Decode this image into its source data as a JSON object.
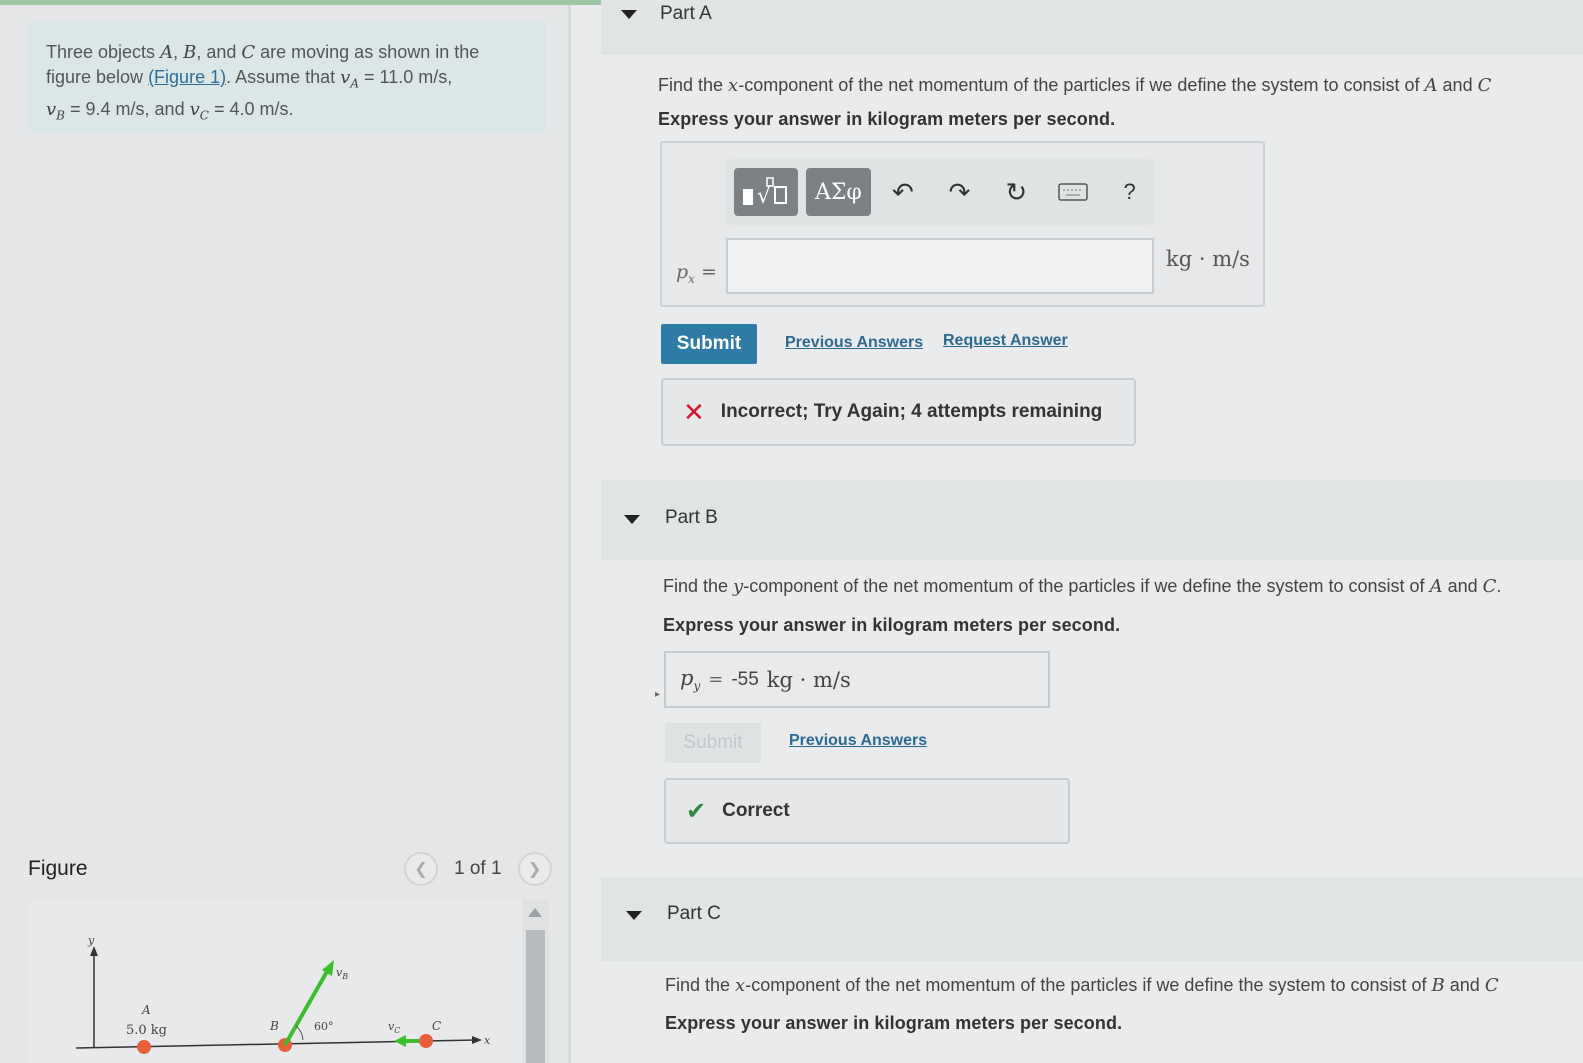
{
  "problem": {
    "intro_1": "Three objects ",
    "obj_a": "A",
    "sep_1": ", ",
    "obj_b": "B",
    "sep_2": ", and ",
    "obj_c": "C",
    "intro_2": " are moving as shown in the",
    "intro_3": "figure below ",
    "figure_link": "(Figure 1)",
    "intro_4": ". Assume that ",
    "va_eq": "v",
    "va_sub": "A",
    "va_val": " = 11.0 m/s,",
    "vb_eq": "v",
    "vb_sub": "B",
    "vb_val": " = 9.4 m/s",
    "intro_5": ", and ",
    "vc_eq": "v",
    "vc_sub": "C",
    "vc_val": " = 4.0 m/s."
  },
  "figure": {
    "label": "Figure",
    "prev_icon": "chevron-left-icon",
    "next_icon": "chevron-right-icon",
    "count": "1 of 1",
    "axis_y": "y",
    "axis_x": "x",
    "label_a": "A",
    "mass_a": "5.0 kg",
    "label_b": "B",
    "angle": "60°",
    "label_vb": "v",
    "label_vb_sub": "B",
    "label_vc": "v",
    "label_vc_sub": "C",
    "label_c": "C",
    "colors": {
      "particle": "#e8603a",
      "vector": "#3bbf2e"
    }
  },
  "part_a": {
    "title": "Part A",
    "question_1": "Find the ",
    "question_var": "x",
    "question_2": "-component of the net momentum of the particles if we define the system to consist of ",
    "question_a": "A",
    "question_and": " and ",
    "question_c": "C",
    "instruction": "Express your answer in kilogram meters per second.",
    "toolbar": {
      "template_icon": "math-template-icon",
      "greek_label": "ΑΣφ",
      "undo_icon": "undo-icon",
      "redo_icon": "redo-icon",
      "reset_icon": "reset-icon",
      "keyboard_icon": "keyboard-icon",
      "help_label": "?"
    },
    "input_label": "p",
    "input_sub": "x",
    "input_eq": " =",
    "input_value": "",
    "unit": "kg · m/s",
    "submit_label": "Submit",
    "previous_answers": "Previous Answers",
    "request_answer": "Request Answer",
    "feedback": "Incorrect; Try Again; 4 attempts remaining",
    "feedback_icon": "x-mark-icon",
    "colors": {
      "submit": "#2e7ba6",
      "incorrect": "#d2162c"
    }
  },
  "part_b": {
    "title": "Part B",
    "question_1": "Find the ",
    "question_var": "y",
    "question_2": "-component of the net momentum of the particles if we define the system to consist of ",
    "question_a": "A",
    "question_and": " and ",
    "question_c": "C",
    "question_end": ".",
    "instruction": "Express your answer in kilogram meters per second.",
    "answer_label": "p",
    "answer_sub": "y",
    "answer_eq": " = ",
    "answer_value": "-55",
    "answer_unit": "kg · m/s",
    "submit_label": "Submit",
    "previous_answers": "Previous Answers",
    "feedback": "Correct",
    "feedback_icon": "checkmark-icon",
    "colors": {
      "correct": "#2f8a3f"
    }
  },
  "part_c": {
    "title": "Part C",
    "question_1": "Find the ",
    "question_var": "x",
    "question_2": "-component of the net momentum of the particles if we define the system to consist of ",
    "question_b": "B",
    "question_and": " and ",
    "question_c": "C",
    "instruction": "Express your answer in kilogram meters per second."
  }
}
